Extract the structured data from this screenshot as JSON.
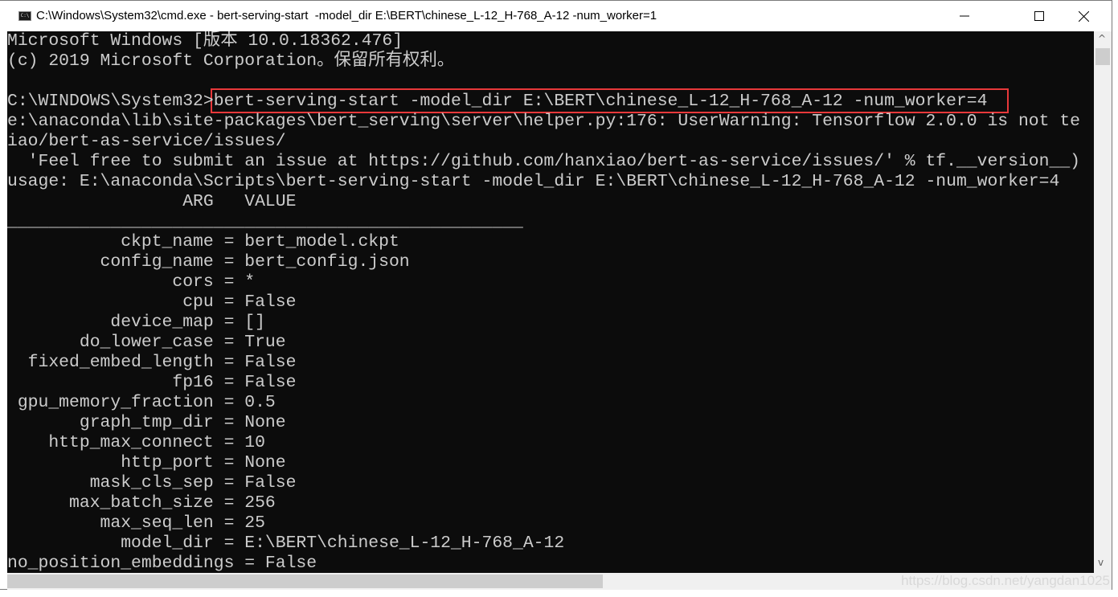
{
  "window": {
    "title": "C:\\Windows\\System32\\cmd.exe - bert-serving-start  -model_dir E:\\BERT\\chinese_L-12_H-768_A-12 -num_worker=1",
    "icon": "cmd-icon",
    "icon_label": "C:\\",
    "controls": {
      "minimize": "minimize-icon",
      "maximize": "maximize-icon",
      "close": "close-icon"
    }
  },
  "console": {
    "highlight_color": "#e8383a",
    "lines": [
      "Microsoft Windows [版本 10.0.18362.476]",
      "(c) 2019 Microsoft Corporation。保留所有权利。",
      "",
      "C:\\WINDOWS\\System32>bert-serving-start -model_dir E:\\BERT\\chinese_L-12_H-768_A-12 -num_worker=4",
      "e:\\anaconda\\lib\\site-packages\\bert_serving\\server\\helper.py:176: UserWarning: Tensorflow 2.0.0 is not te",
      "iao/bert-as-service/issues/",
      "  'Feel free to submit an issue at https://github.com/hanxiao/bert-as-service/issues/' % tf.__version__)",
      "usage: E:\\anaconda\\Scripts\\bert-serving-start -model_dir E:\\BERT\\chinese_L-12_H-768_A-12 -num_worker=4",
      "                 ARG   VALUE",
      "__________________________________________________",
      "           ckpt_name = bert_model.ckpt",
      "         config_name = bert_config.json",
      "                cors = *",
      "                 cpu = False",
      "          device_map = []",
      "       do_lower_case = True",
      "  fixed_embed_length = False",
      "                fp16 = False",
      " gpu_memory_fraction = 0.5",
      "       graph_tmp_dir = None",
      "    http_max_connect = 10",
      "           http_port = None",
      "        mask_cls_sep = False",
      "      max_batch_size = 256",
      "         max_seq_len = 25",
      "           model_dir = E:\\BERT\\chinese_L-12_H-768_A-12",
      "no_position_embeddings = False"
    ]
  },
  "watermark": "https://blog.csdn.net/yangdan1025"
}
